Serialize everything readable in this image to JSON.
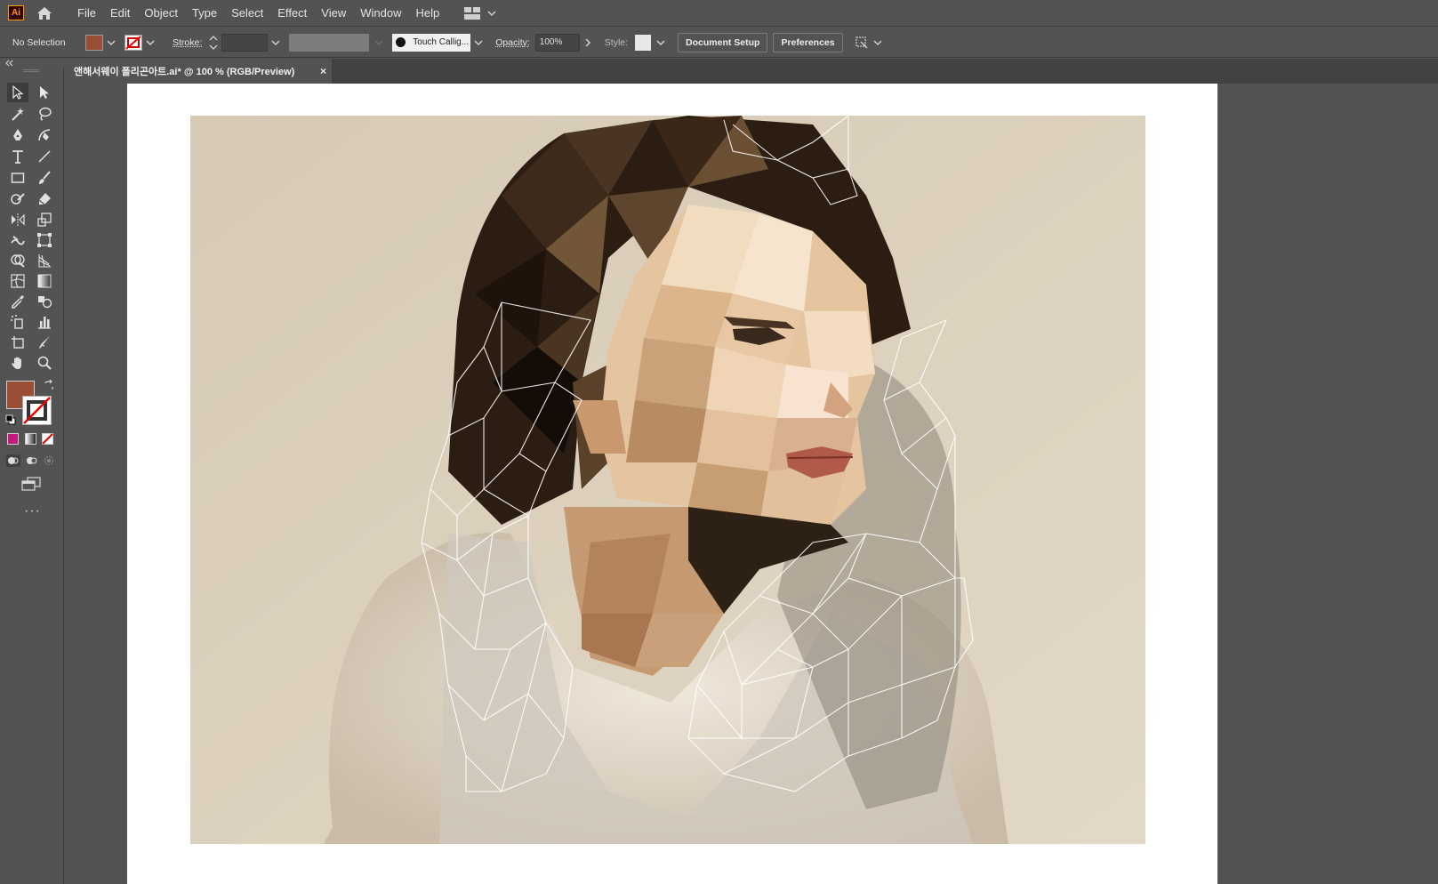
{
  "app": {
    "logo_text": "Ai"
  },
  "menu": [
    "File",
    "Edit",
    "Object",
    "Type",
    "Select",
    "Effect",
    "View",
    "Window",
    "Help"
  ],
  "control_bar": {
    "selection": "No Selection",
    "stroke_label": "Stroke:",
    "brush_name": "Touch Callig...",
    "opacity_label": "Opacity:",
    "opacity_value": "100%",
    "style_label": "Style:",
    "document_setup": "Document Setup",
    "preferences": "Preferences"
  },
  "document_tab": {
    "title": "앤해서웨이 폴리곤아트.ai* @ 100 % (RGB/Preview)",
    "close": "×"
  },
  "colors": {
    "fill": "#9a4e36",
    "accent_select": "#3d3d3d",
    "ui_bg": "#535353",
    "artboard": "#ffffff",
    "mesh_stroke": "#ffffff"
  },
  "tools": [
    "selection-tool",
    "direct-selection-tool",
    "magic-wand-tool",
    "lasso-tool",
    "pen-tool",
    "curvature-tool",
    "type-tool",
    "line-segment-tool",
    "rectangle-tool",
    "paintbrush-tool",
    "shaper-tool",
    "eraser-tool",
    "rotate-tool",
    "scale-tool",
    "warp-tool",
    "free-transform-tool",
    "shape-builder-tool",
    "perspective-grid-tool",
    "mesh-tool",
    "gradient-tool",
    "eyedropper-tool",
    "blend-tool",
    "symbol-sprayer-tool",
    "column-graph-tool",
    "artboard-tool",
    "slice-tool",
    "hand-tool",
    "zoom-tool"
  ]
}
